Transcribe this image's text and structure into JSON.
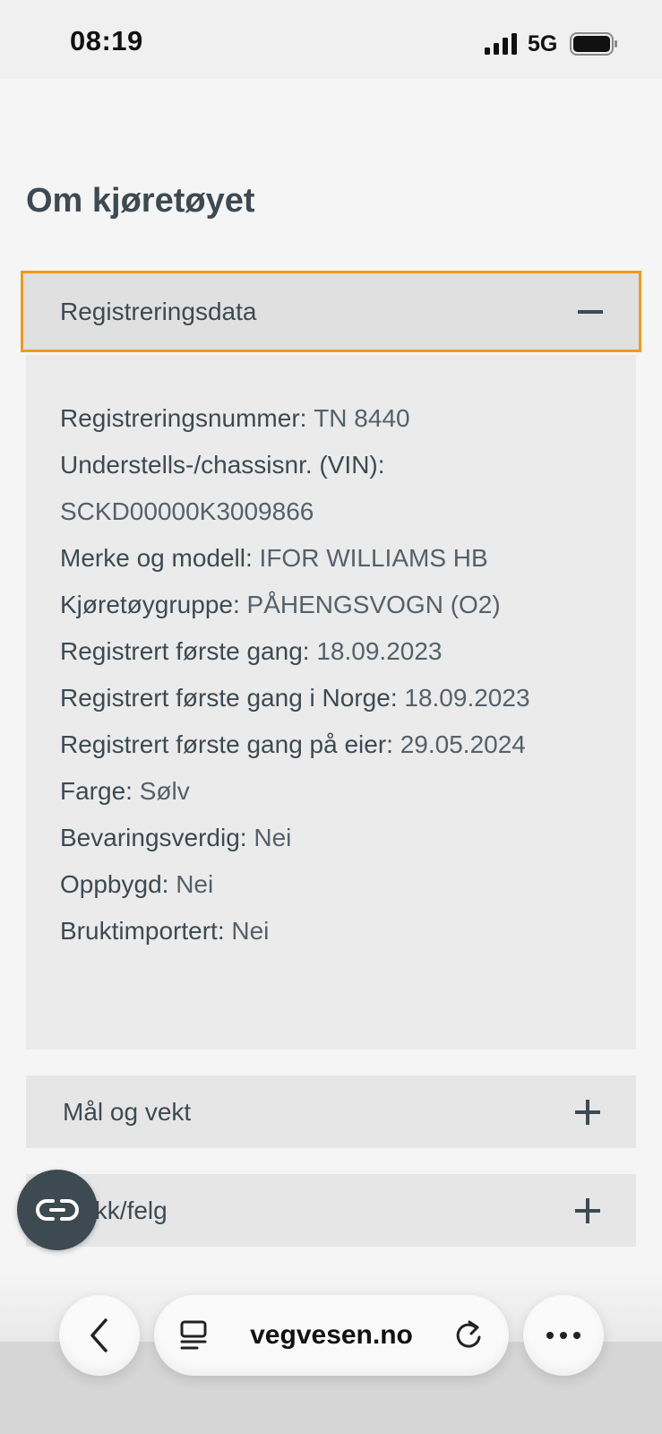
{
  "status_bar": {
    "time": "08:19",
    "network": "5G"
  },
  "page": {
    "title": "Om kjøretøyet"
  },
  "sections": [
    {
      "label": "Registreringsdata",
      "expanded": true
    },
    {
      "label": "Mål og vekt",
      "expanded": false
    },
    {
      "label": "Dekk/felg",
      "expanded": false
    }
  ],
  "registration": {
    "rows": [
      {
        "key": "Registreringsnummer:",
        "value": "TN 8440"
      },
      {
        "key": "Understells-/chassisnr. (VIN):",
        "value": ""
      },
      {
        "key": "",
        "value": "SCKD00000K3009866"
      },
      {
        "key": "Merke og modell:",
        "value": "IFOR WILLIAMS HB"
      },
      {
        "key": "Kjøretøygruppe:",
        "value": "PÅHENGSVOGN (O2)"
      },
      {
        "key": "Registrert første gang:",
        "value": "18.09.2023"
      },
      {
        "key": "Registrert første gang i Norge:",
        "value": "18.09.2023"
      },
      {
        "key": "Registrert første gang på eier:",
        "value": "29.05.2024"
      },
      {
        "key": "Farge:",
        "value": "Sølv"
      },
      {
        "key": "Bevaringsverdig:",
        "value": "Nei"
      },
      {
        "key": "Oppbygd:",
        "value": "Nei"
      },
      {
        "key": "Bruktimportert:",
        "value": "Nei"
      }
    ]
  },
  "browser": {
    "url": "vegvesen.no"
  },
  "icons": {
    "signal": "signal-icon",
    "battery": "battery-icon",
    "reader": "reader-icon",
    "back": "chevron-left-icon",
    "tabs": "tabs-icon",
    "reload": "reload-icon",
    "more": "more-icon",
    "collapse": "minus-icon",
    "expand": "plus-icon"
  },
  "colors": {
    "focus_outline": "#f09a1f",
    "text": "#3d4a52",
    "accordion_bg": "#e3e3e3",
    "body_bg": "#ebebeb"
  }
}
